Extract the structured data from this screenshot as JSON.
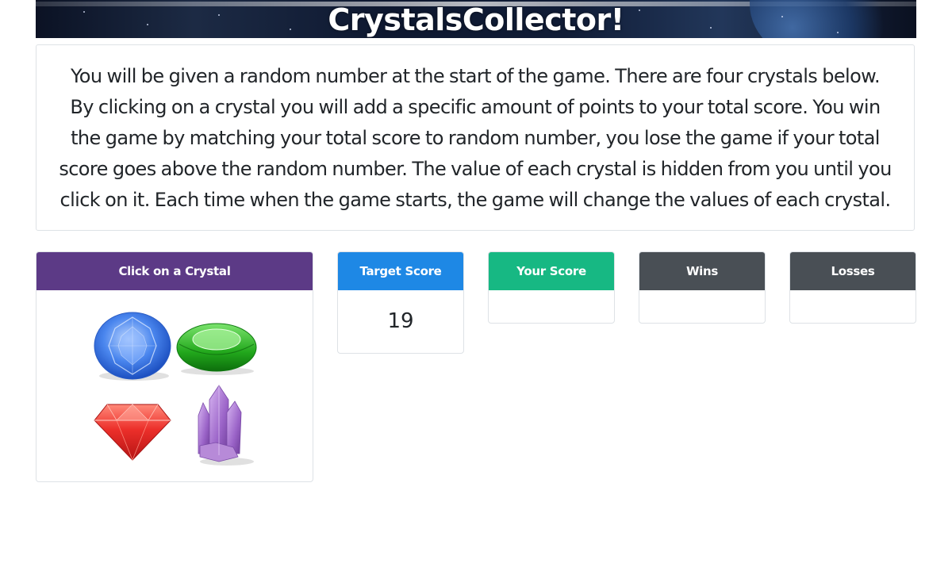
{
  "header": {
    "title": "CrystalsCollector!"
  },
  "instructions": {
    "text": "You will be given a random number at the start of the game. There are four crystals below. By clicking on a crystal you will add a specific amount of points to your total score. You win the game by matching your total score to random number, you lose the game if your total score goes above the random number. The value of each crystal is hidden from you until you click on it. Each time when the game starts, the game will change the values of each crystal."
  },
  "crystal_panel": {
    "label": "Click on a Crystal",
    "crystals": [
      {
        "icon": "blue-crystal-icon",
        "color": "#3d7be6"
      },
      {
        "icon": "green-crystal-icon",
        "color": "#2fbf2a"
      },
      {
        "icon": "red-crystal-icon",
        "color": "#e62a2a"
      },
      {
        "icon": "purple-crystal-icon",
        "color": "#9b64c8"
      }
    ]
  },
  "scores": {
    "target": {
      "label": "Target Score",
      "value": "19",
      "color": "#1e88e5"
    },
    "yours": {
      "label": "Your Score",
      "value": "",
      "color": "#17b883"
    },
    "wins": {
      "label": "Wins",
      "value": "",
      "color": "#494f55"
    },
    "losses": {
      "label": "Losses",
      "value": "",
      "color": "#494f55"
    }
  },
  "colors": {
    "crystal_header": "#5c3a86"
  }
}
